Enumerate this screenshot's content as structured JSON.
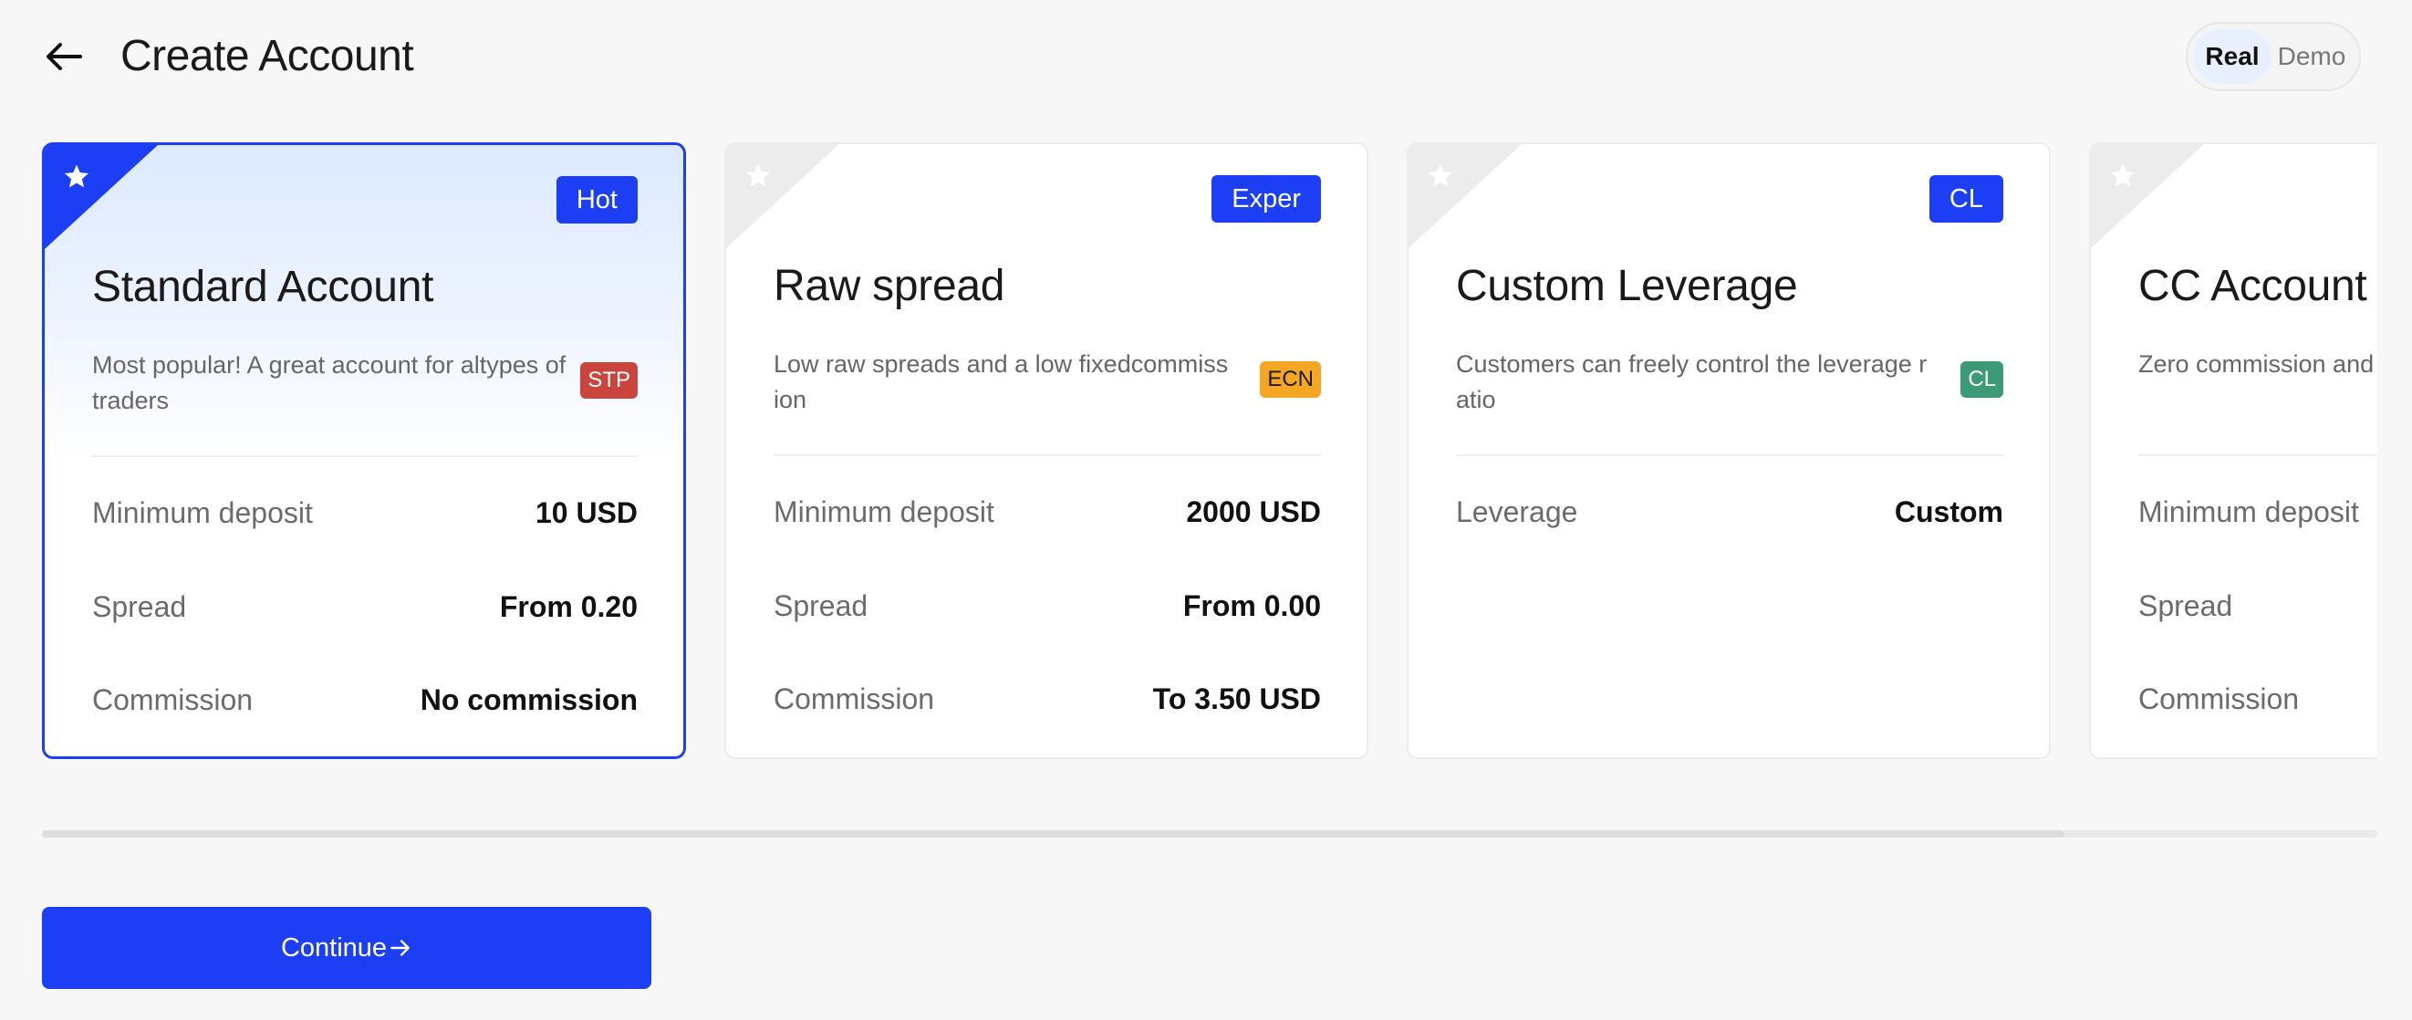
{
  "header": {
    "title": "Create Account",
    "mode_options": [
      {
        "label": "Real",
        "active": true
      },
      {
        "label": "Demo",
        "active": false
      }
    ]
  },
  "cards": [
    {
      "title": "Standard Account",
      "tag": "Hot",
      "description": "Most popular! A great account for altypes of traders",
      "badge": {
        "label": "STP",
        "color": "#c9453d"
      },
      "selected": true,
      "rows": [
        {
          "label": "Minimum deposit",
          "value": "10 USD"
        },
        {
          "label": "Spread",
          "value": "From 0.20"
        },
        {
          "label": "Commission",
          "value": "No commission"
        }
      ]
    },
    {
      "title": "Raw spread",
      "tag": "Exper",
      "description": "Low raw spreads and a low fixedcommiss ion",
      "badge": {
        "label": "ECN",
        "color": "#f5a623",
        "text_color": "#1a1a1a"
      },
      "selected": false,
      "rows": [
        {
          "label": "Minimum deposit",
          "value": "2000 USD"
        },
        {
          "label": "Spread",
          "value": "From 0.00"
        },
        {
          "label": "Commission",
          "value": "To 3.50 USD"
        }
      ]
    },
    {
      "title": "Custom Leverage",
      "tag": "CL",
      "description": "Customers can freely control the leverage r atio",
      "badge": {
        "label": "CL",
        "color": "#3d9a76"
      },
      "selected": false,
      "rows": [
        {
          "label": "Leverage",
          "value": "Custom"
        }
      ]
    },
    {
      "title": "CC Account",
      "tag": "",
      "description": "Zero commission and th instant or market e",
      "badge": null,
      "selected": false,
      "rows": [
        {
          "label": "Minimum deposit",
          "value": ""
        },
        {
          "label": "Spread",
          "value": ""
        },
        {
          "label": "Commission",
          "value": ""
        }
      ]
    }
  ],
  "scrollbar": {
    "visible_fraction": 0.866
  },
  "continue_label": "Continue",
  "icons": {
    "back": "arrow-left-icon",
    "corner": "star-icon",
    "continue": "arrow-right-icon"
  },
  "colors": {
    "accent": "#1c3ff5",
    "background": "#f7f7f7",
    "selected_bg": "#dce9ff"
  }
}
